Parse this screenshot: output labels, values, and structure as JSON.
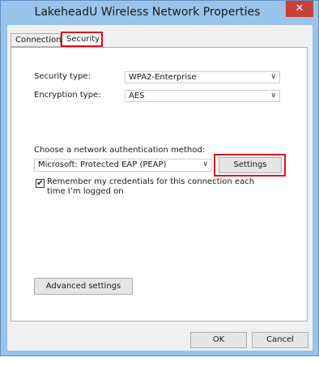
{
  "window": {
    "title": "LakeheadU Wireless Network Properties",
    "close_glyph": "✕"
  },
  "tabs": [
    {
      "label": "Connection",
      "active": false
    },
    {
      "label": "Security",
      "active": true
    }
  ],
  "security": {
    "security_type_label": "Security type:",
    "security_type_value": "WPA2-Enterprise",
    "encryption_type_label": "Encryption type:",
    "encryption_type_value": "AES",
    "auth_method_label": "Choose a network authentication method:",
    "auth_method_value": "Microsoft: Protected EAP (PEAP)",
    "settings_button": "Settings",
    "remember_checked": true,
    "remember_label": "Remember my credentials for this connection each time I’m logged on",
    "advanced_button": "Advanced settings"
  },
  "footer": {
    "ok_button": "OK",
    "cancel_button": "Cancel"
  },
  "icons": {
    "chevron": "∨",
    "checkmark": "✔"
  },
  "colors": {
    "highlight_red": "#e0101a",
    "window_blue": "#99c3ea",
    "close_red": "#c7403a"
  }
}
